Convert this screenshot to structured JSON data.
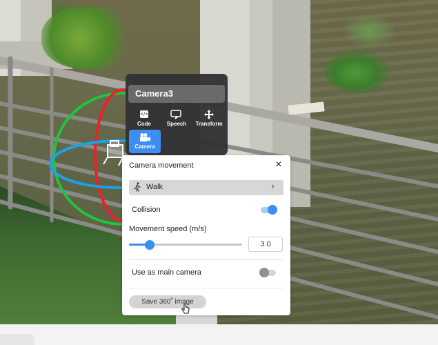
{
  "object": {
    "name": "Camera3"
  },
  "toolbar": {
    "code_label": "Code",
    "speech_label": "Speech",
    "transform_label": "Transform",
    "camera_label": "Camera"
  },
  "panel": {
    "title": "Camera movement",
    "mode_label": "Walk",
    "collision_label": "Collision",
    "collision_on": true,
    "speed_label": "Movement speed (m/s)",
    "speed_value": "3.0",
    "speed_fraction": 0.18,
    "main_camera_label": "Use as main camera",
    "main_camera_on": false,
    "save_label": "Save 360˚ image"
  },
  "colors": {
    "accent": "#3d8ef3",
    "toolbar_bg": "#323234",
    "gizmo_x": "#e8232a",
    "gizmo_y": "#20c43c",
    "gizmo_z": "#1aa3e8"
  }
}
